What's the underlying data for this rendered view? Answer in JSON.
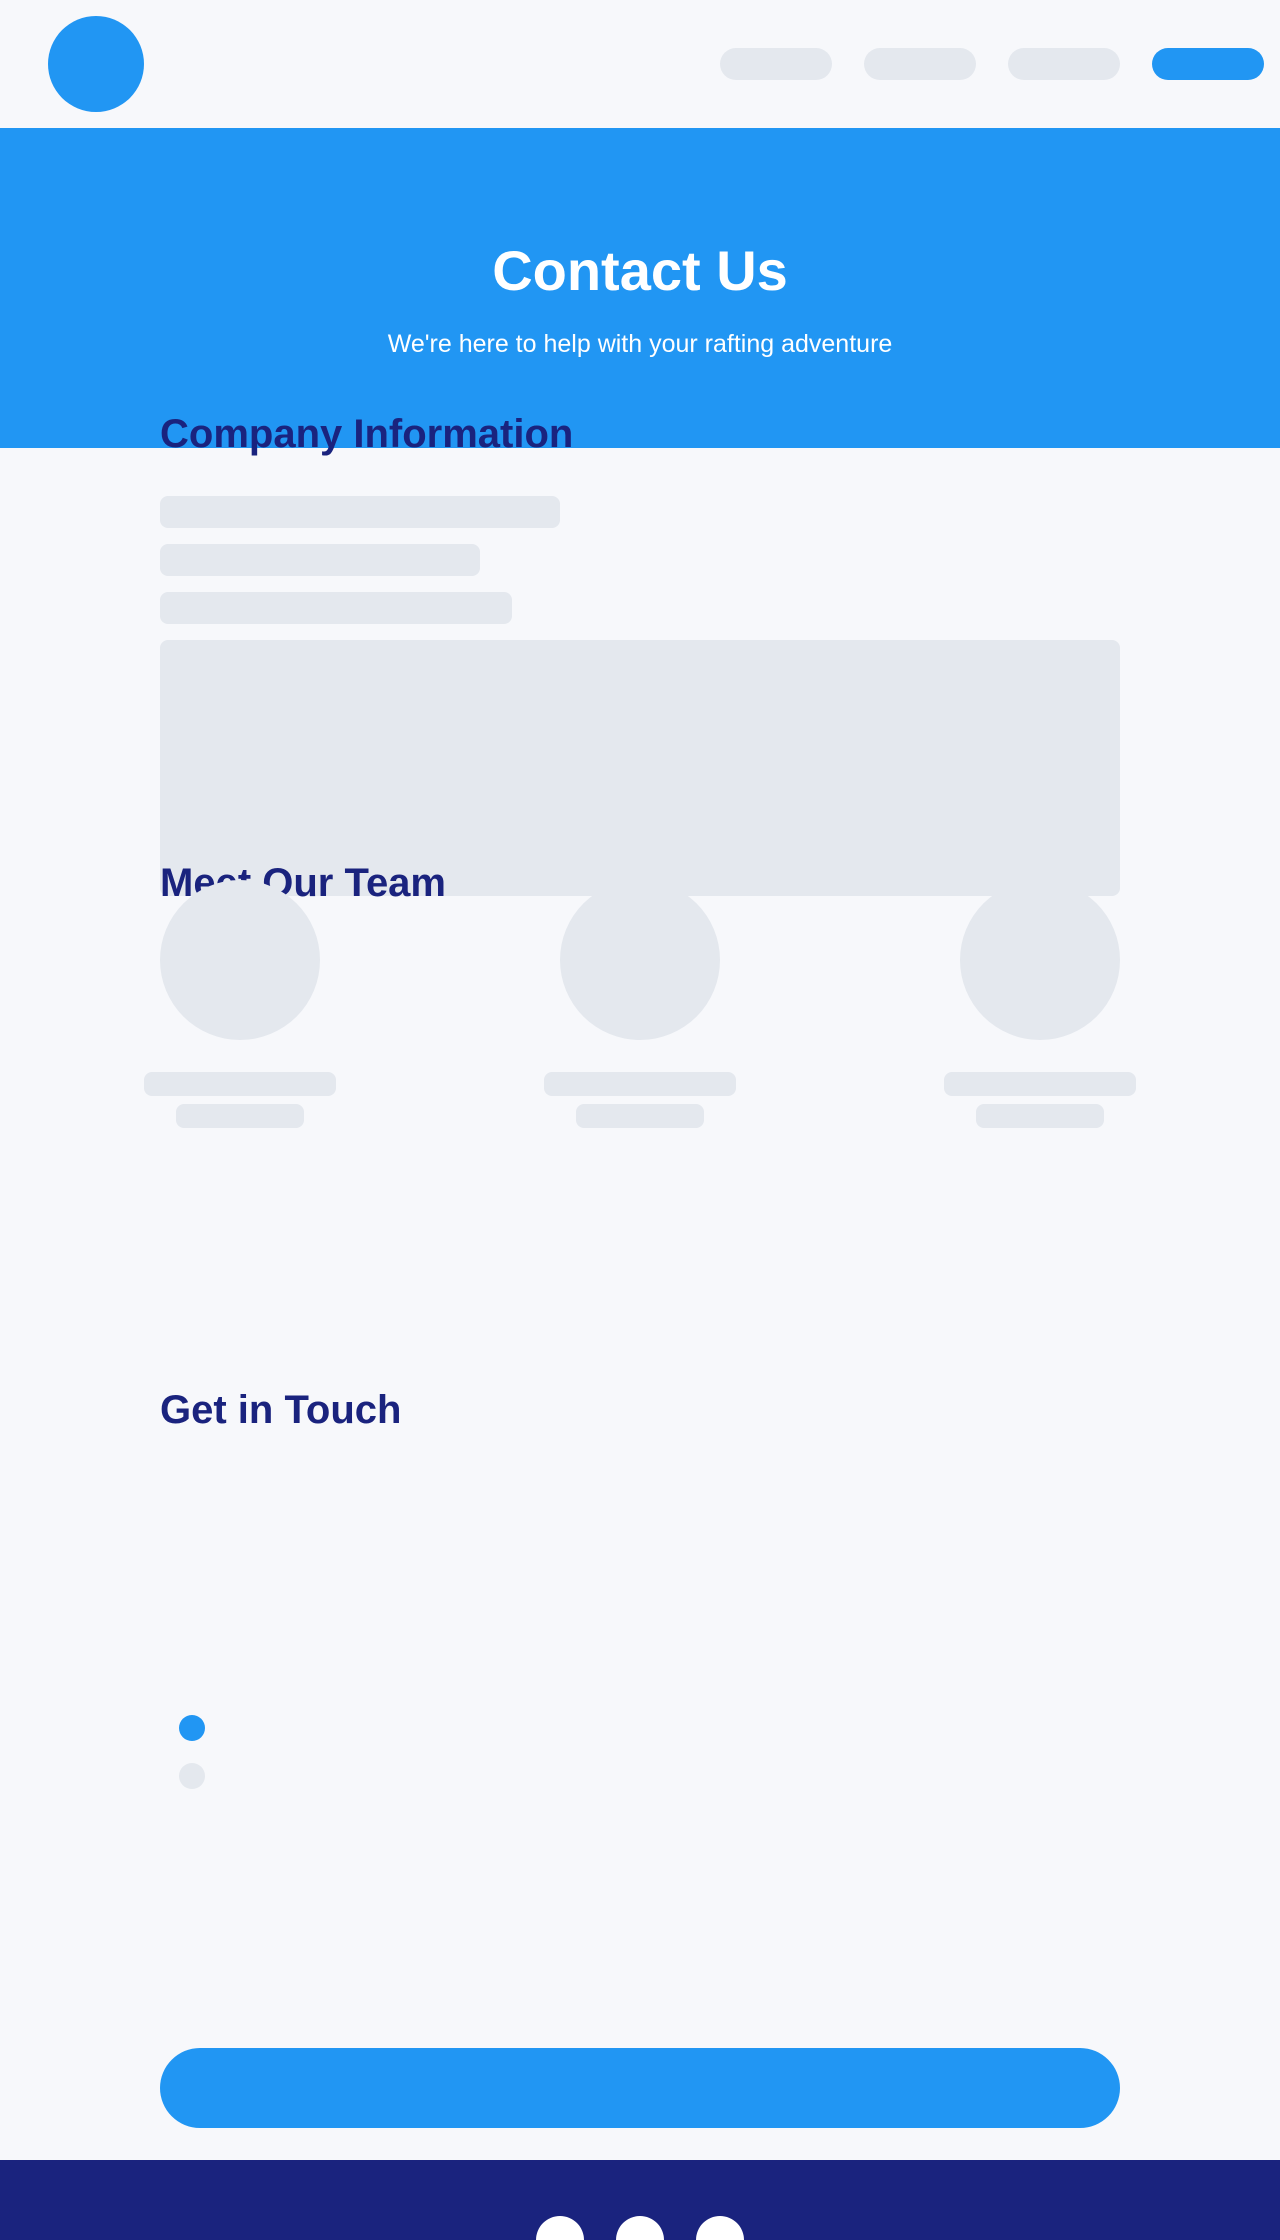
{
  "hero": {
    "title": "Contact Us",
    "subtitle": "We're here to help with your rafting adventure"
  },
  "sections": {
    "company_info_title": "Company Information",
    "team_title": "Meet Our Team",
    "get_in_touch_title": "Get in Touch"
  },
  "colors": {
    "primary": "#2196f3",
    "navy": "#1a237e",
    "skeleton": "#e4e8ee",
    "background": "#f7f8fb"
  },
  "contact_options": {
    "selected_index": 0,
    "count": 2
  },
  "footer": {
    "social_icons": [
      "social-icon-1",
      "social-icon-2",
      "social-icon-3"
    ]
  }
}
